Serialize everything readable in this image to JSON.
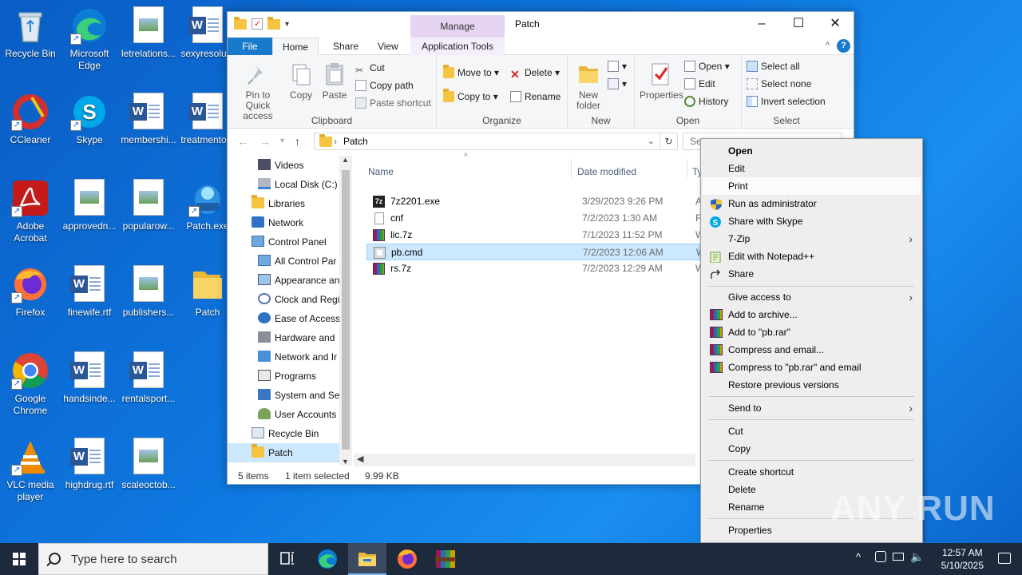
{
  "desktop": {
    "icons": [
      {
        "label": "Recycle Bin"
      },
      {
        "label": "Microsoft Edge"
      },
      {
        "label": "letrelations..."
      },
      {
        "label": "sexyresolu..."
      },
      {
        "label": "CCleaner"
      },
      {
        "label": "Skype"
      },
      {
        "label": "membershi..."
      },
      {
        "label": "treatmento..."
      },
      {
        "label": "Adobe Acrobat"
      },
      {
        "label": "approvedn..."
      },
      {
        "label": "popularow..."
      },
      {
        "label": "Patch.exe"
      },
      {
        "label": "Firefox"
      },
      {
        "label": "finewife.rtf"
      },
      {
        "label": "publishers..."
      },
      {
        "label": "Patch"
      },
      {
        "label": "Google Chrome"
      },
      {
        "label": "handsinde..."
      },
      {
        "label": "rentalsport..."
      },
      {
        "label": "VLC media player"
      },
      {
        "label": "highdrug.rtf"
      },
      {
        "label": "scaleoctob..."
      }
    ]
  },
  "window": {
    "title": "Patch",
    "manage_label": "Manage",
    "tabs": {
      "file": "File",
      "home": "Home",
      "share": "Share",
      "view": "View",
      "app_tools": "Application Tools"
    },
    "ribbon": {
      "clipboard": {
        "label": "Clipboard",
        "pin": "Pin to Quick access",
        "copy": "Copy",
        "paste": "Paste",
        "cut": "Cut",
        "copy_path": "Copy path",
        "paste_shortcut": "Paste shortcut"
      },
      "organize": {
        "label": "Organize",
        "move_to": "Move to",
        "copy_to": "Copy to",
        "delete": "Delete",
        "rename": "Rename"
      },
      "new": {
        "label": "New",
        "new_folder": "New folder"
      },
      "open": {
        "label": "Open",
        "properties": "Properties",
        "open": "Open",
        "edit": "Edit",
        "history": "History"
      },
      "select": {
        "label": "Select",
        "select_all": "Select all",
        "select_none": "Select none",
        "invert": "Invert selection"
      }
    },
    "address": {
      "path": "Patch",
      "search_placeholder": "Sea"
    },
    "nav": [
      {
        "label": "Videos"
      },
      {
        "label": "Local Disk (C:)"
      },
      {
        "label": "Libraries"
      },
      {
        "label": "Network"
      },
      {
        "label": "Control Panel"
      },
      {
        "label": "All Control Par"
      },
      {
        "label": "Appearance an"
      },
      {
        "label": "Clock and Regi"
      },
      {
        "label": "Ease of Access"
      },
      {
        "label": "Hardware and"
      },
      {
        "label": "Network and Ir"
      },
      {
        "label": "Programs"
      },
      {
        "label": "System and Sec"
      },
      {
        "label": "User Accounts"
      },
      {
        "label": "Recycle Bin"
      },
      {
        "label": "Patch"
      }
    ],
    "columns": {
      "name": "Name",
      "date": "Date modified",
      "type": "Ty"
    },
    "files": [
      {
        "name": "7z2201.exe",
        "date": "3/29/2023 9:26 PM",
        "type": "Ap"
      },
      {
        "name": "cnf",
        "date": "7/2/2023 1:30 AM",
        "type": "Fil"
      },
      {
        "name": "lic.7z",
        "date": "7/1/2023 11:52 PM",
        "type": "W"
      },
      {
        "name": "pb.cmd",
        "date": "7/2/2023 12:06 AM",
        "type": "W"
      },
      {
        "name": "rs.7z",
        "date": "7/2/2023 12:29 AM",
        "type": "W"
      }
    ],
    "status": {
      "count": "5 items",
      "selected": "1 item selected",
      "size": "9.99 KB"
    }
  },
  "context_menu": {
    "items": [
      {
        "label": "Open"
      },
      {
        "label": "Edit"
      },
      {
        "label": "Print"
      },
      {
        "label": "Run as administrator"
      },
      {
        "label": "Share with Skype"
      },
      {
        "label": "7-Zip"
      },
      {
        "label": "Edit with Notepad++"
      },
      {
        "label": "Share"
      },
      {
        "label": "Give access to"
      },
      {
        "label": "Add to archive..."
      },
      {
        "label": "Add to \"pb.rar\""
      },
      {
        "label": "Compress and email..."
      },
      {
        "label": "Compress to \"pb.rar\" and email"
      },
      {
        "label": "Restore previous versions"
      },
      {
        "label": "Send to"
      },
      {
        "label": "Cut"
      },
      {
        "label": "Copy"
      },
      {
        "label": "Create shortcut"
      },
      {
        "label": "Delete"
      },
      {
        "label": "Rename"
      },
      {
        "label": "Properties"
      }
    ]
  },
  "taskbar": {
    "search_placeholder": "Type here to search",
    "time": "12:57 AM",
    "date": "5/10/2025"
  },
  "watermark": "ANY RUN"
}
